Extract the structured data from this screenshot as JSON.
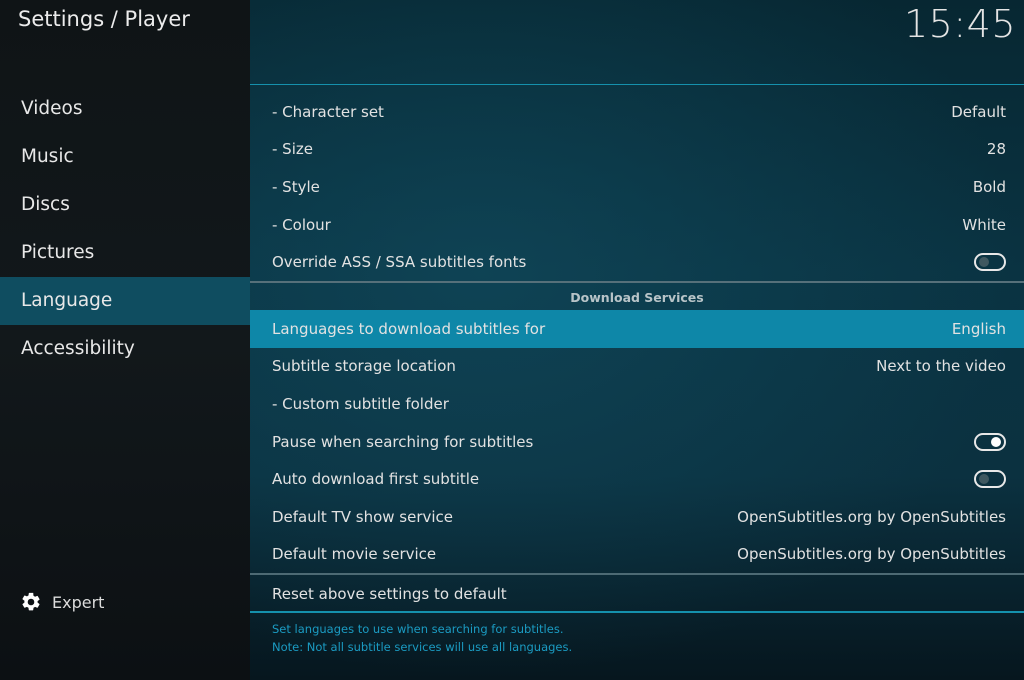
{
  "window": {
    "title": "Settings / Player",
    "clock": "15:45"
  },
  "sidebar": {
    "items": [
      {
        "label": "Videos",
        "active": false
      },
      {
        "label": "Music",
        "active": false
      },
      {
        "label": "Discs",
        "active": false
      },
      {
        "label": "Pictures",
        "active": false
      },
      {
        "label": "Language",
        "active": true
      },
      {
        "label": "Accessibility",
        "active": false
      }
    ],
    "level": {
      "icon": "gear-icon",
      "label": "Expert"
    }
  },
  "settings": {
    "rows_top": [
      {
        "label": "- Character set",
        "value": "Default"
      },
      {
        "label": "- Size",
        "value": "28"
      },
      {
        "label": "- Style",
        "value": "Bold"
      },
      {
        "label": "- Colour",
        "value": "White"
      },
      {
        "label": "Override ASS / SSA subtitles fonts",
        "toggle": false
      }
    ],
    "section_title": "Download Services",
    "rows_download": [
      {
        "label": "Languages to download subtitles for",
        "value": "English",
        "focused": true
      },
      {
        "label": "Subtitle storage location",
        "value": "Next to the video"
      },
      {
        "label": "- Custom subtitle folder",
        "value": ""
      },
      {
        "label": "Pause when searching for subtitles",
        "toggle": true
      },
      {
        "label": "Auto download first subtitle",
        "toggle": false
      },
      {
        "label": "Default TV show service",
        "value": "OpenSubtitles.org by OpenSubtitles"
      },
      {
        "label": "Default movie service",
        "value": "OpenSubtitles.org by OpenSubtitles"
      }
    ],
    "reset_label": "Reset above settings to default"
  },
  "help": {
    "line1": "Set languages to use when searching for subtitles.",
    "line2": "Note: Not all subtitle services will use all languages."
  },
  "colors": {
    "accent": "#0e87a8",
    "sidebar_active": "#0f4d60",
    "help_text": "#1b9bc2"
  }
}
